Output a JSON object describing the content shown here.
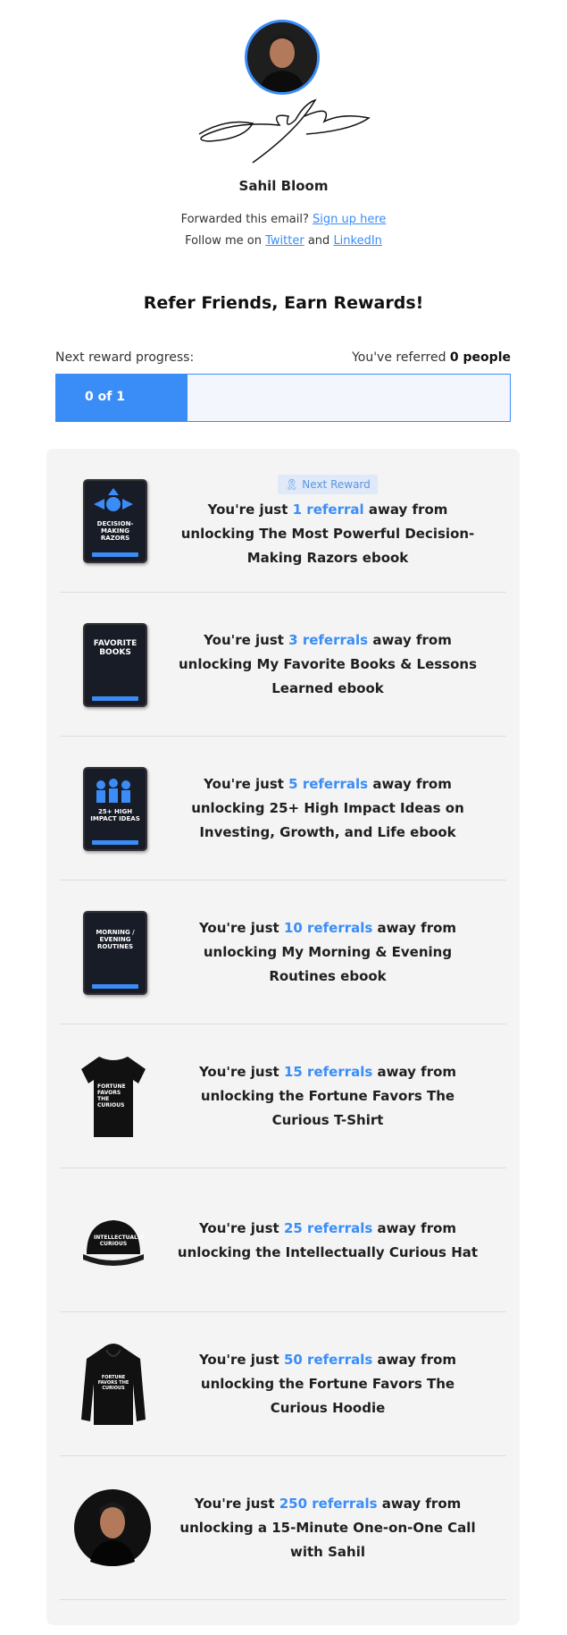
{
  "author": {
    "name": "Sahil Bloom"
  },
  "header": {
    "forwarded_text": "Forwarded this email?",
    "signup_link": "Sign up here",
    "follow_text": "Follow me on",
    "twitter_link": "Twitter",
    "and_text": "and",
    "linkedin_link": "LinkedIn"
  },
  "referral": {
    "title": "Refer Friends, Earn Rewards!",
    "progress_label": "Next reward progress:",
    "referred_prefix": "You've referred",
    "referred_count": "0 people",
    "progress_text": "0 of 1",
    "progress_fraction": 0.29,
    "accent_color": "#3a8df7"
  },
  "rewards": [
    {
      "badge": "Next Reward",
      "prefix": "You're just",
      "count": "1 referral",
      "middle": "away from unlocking",
      "item": "The Most Powerful Decision-Making Razors ebook",
      "image_label": "DECISION-MAKING RAZORS"
    },
    {
      "prefix": "You're just",
      "count": "3 referrals",
      "middle": "away from unlocking",
      "item": "My Favorite Books & Lessons Learned ebook",
      "image_label": "FAVORITE BOOKS"
    },
    {
      "prefix": "You're just",
      "count": "5 referrals",
      "middle": "away from unlocking",
      "item": "25+ High Impact Ideas on Investing, Growth, and Life ebook",
      "image_label": "25+ HIGH IMPACT IDEAS"
    },
    {
      "prefix": "You're just",
      "count": "10 referrals",
      "middle": "away from unlocking",
      "item": "My Morning & Evening Routines ebook",
      "image_label": "MORNING / EVENING ROUTINES"
    },
    {
      "prefix": "You're just",
      "count": "15 referrals",
      "middle": "away from unlocking",
      "item": "the Fortune Favors The Curious T-Shirt",
      "image_label": "FORTUNE FAVORS THE CURIOUS"
    },
    {
      "prefix": "You're just",
      "count": "25 referrals",
      "middle": "away from unlocking",
      "item": "the Intellectually Curious Hat",
      "image_label": "INTELLECTUALLY CURIOUS"
    },
    {
      "prefix": "You're just",
      "count": "50 referrals",
      "middle": "away from unlocking",
      "item": "the Fortune Favors The Curious Hoodie",
      "image_label": "FORTUNE FAVORS THE CURIOUS"
    },
    {
      "prefix": "You're just",
      "count": "250 referrals",
      "middle": "away from unlocking",
      "item": "a 15-Minute One-on-One Call with Sahil"
    }
  ]
}
